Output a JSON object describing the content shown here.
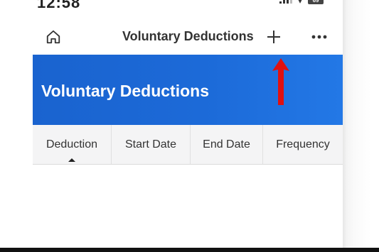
{
  "status_bar": {
    "time": "12:58",
    "battery": "69"
  },
  "nav": {
    "title": "Voluntary Deductions",
    "icons": {
      "home": "home-icon",
      "add": "plus-icon",
      "more": "more-horizontal-icon"
    }
  },
  "header": {
    "title": "Voluntary Deductions",
    "color": "#1a63cf"
  },
  "annotation": {
    "type": "arrow-up",
    "color": "#e01010"
  },
  "tabs": [
    {
      "label": "Deduction",
      "selected": true
    },
    {
      "label": "Start Date",
      "selected": false
    },
    {
      "label": "End Date",
      "selected": false
    },
    {
      "label": "Frequency",
      "selected": false
    }
  ]
}
